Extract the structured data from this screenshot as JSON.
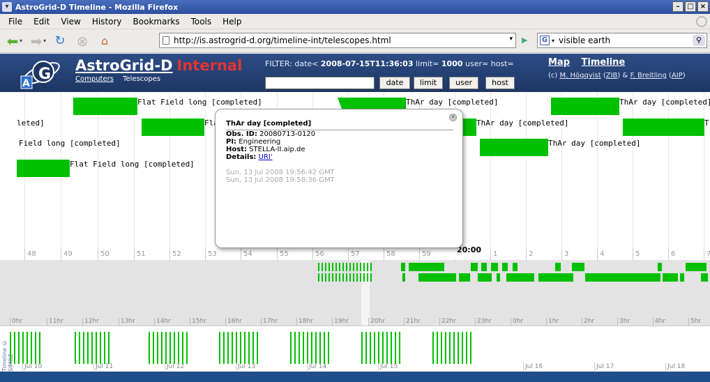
{
  "window": {
    "title": "AstroGrid-D Timeline - Mozilla Firefox",
    "app_icon": "firefox-icon"
  },
  "menu": {
    "items": [
      "File",
      "Edit",
      "View",
      "History",
      "Bookmarks",
      "Tools",
      "Help"
    ]
  },
  "nav": {
    "url": "http://is.astrogrid-d.org/timeline-int/telescopes.html",
    "search_engine": "G",
    "search_value": "visible earth"
  },
  "site": {
    "brand": "AstroGrid-D",
    "brand_suffix": "Internal",
    "sublinks": [
      "Computers",
      "Telescopes"
    ],
    "filter_prefix": "FILTER: date<",
    "filter_date": "2008-07-15T11:36:03",
    "filter_limit_label": "limit=",
    "filter_limit": "1000",
    "filter_user_host": "user= host=",
    "buttons": [
      "date",
      "limit",
      "user",
      "host"
    ],
    "links": [
      "Map",
      "Timeline"
    ],
    "credit_prefix": "(c)",
    "credit_author1": "M. Högqvist",
    "credit_org1": "ZIB",
    "credit_author2": "F. Breitling",
    "credit_org2": "AIP",
    "accent": "#e33333"
  },
  "timeline": {
    "events": [
      {
        "label": "Flat Field long [completed]"
      },
      {
        "label": "ThAr day [completed]"
      },
      {
        "label": "ThAr day [completed]"
      },
      {
        "label": "leted]"
      },
      {
        "label": "Fla"
      },
      {
        "label": "ThAr day [completed]"
      },
      {
        "label": "T"
      },
      {
        "label": "Field long [completed]"
      },
      {
        "label": "ThAr day [completed]"
      },
      {
        "label": "Flat Field long [completed]"
      }
    ],
    "ticks": [
      "48",
      "49",
      "50",
      "51",
      "52",
      "53",
      "54",
      "55",
      "56",
      "57",
      "58",
      "59",
      "20:00",
      "1",
      "2",
      "3",
      "4",
      "5",
      "6",
      "7"
    ],
    "hour_ticks": [
      "0hr",
      "11hr",
      "12hr",
      "13hr",
      "14hr",
      "15hr",
      "16hr",
      "17hr",
      "18hr",
      "19hr",
      "20hr",
      "21hr",
      "22hr",
      "23hr",
      "0hr",
      "1hr",
      "2hr",
      "3hr",
      "4hr",
      "5hr"
    ],
    "day_ticks": [
      "Jul 10",
      "Jul 11",
      "Jul 12",
      "Jul 13",
      "Jul 14",
      "Jul 15",
      "Jul 16",
      "Jul 17",
      "Jul 18"
    ],
    "vertical_credit": "Timeline © SIMILE",
    "event_color": "#00c000"
  },
  "popup": {
    "title": "ThAr day [completed]",
    "obs_label": "Obs. ID:",
    "obs_id": "20080713-0120",
    "pi_label": "PI:",
    "pi": "Engineering",
    "host_label": "Host:",
    "host": "STELLA-II.aip.de",
    "details_label": "Details:",
    "details_link": "URI'",
    "start": "Sun, 13 Jul 2008 19:56:42 GMT",
    "end": "Sun, 13 Jul 2008 19:58:36 GMT"
  }
}
